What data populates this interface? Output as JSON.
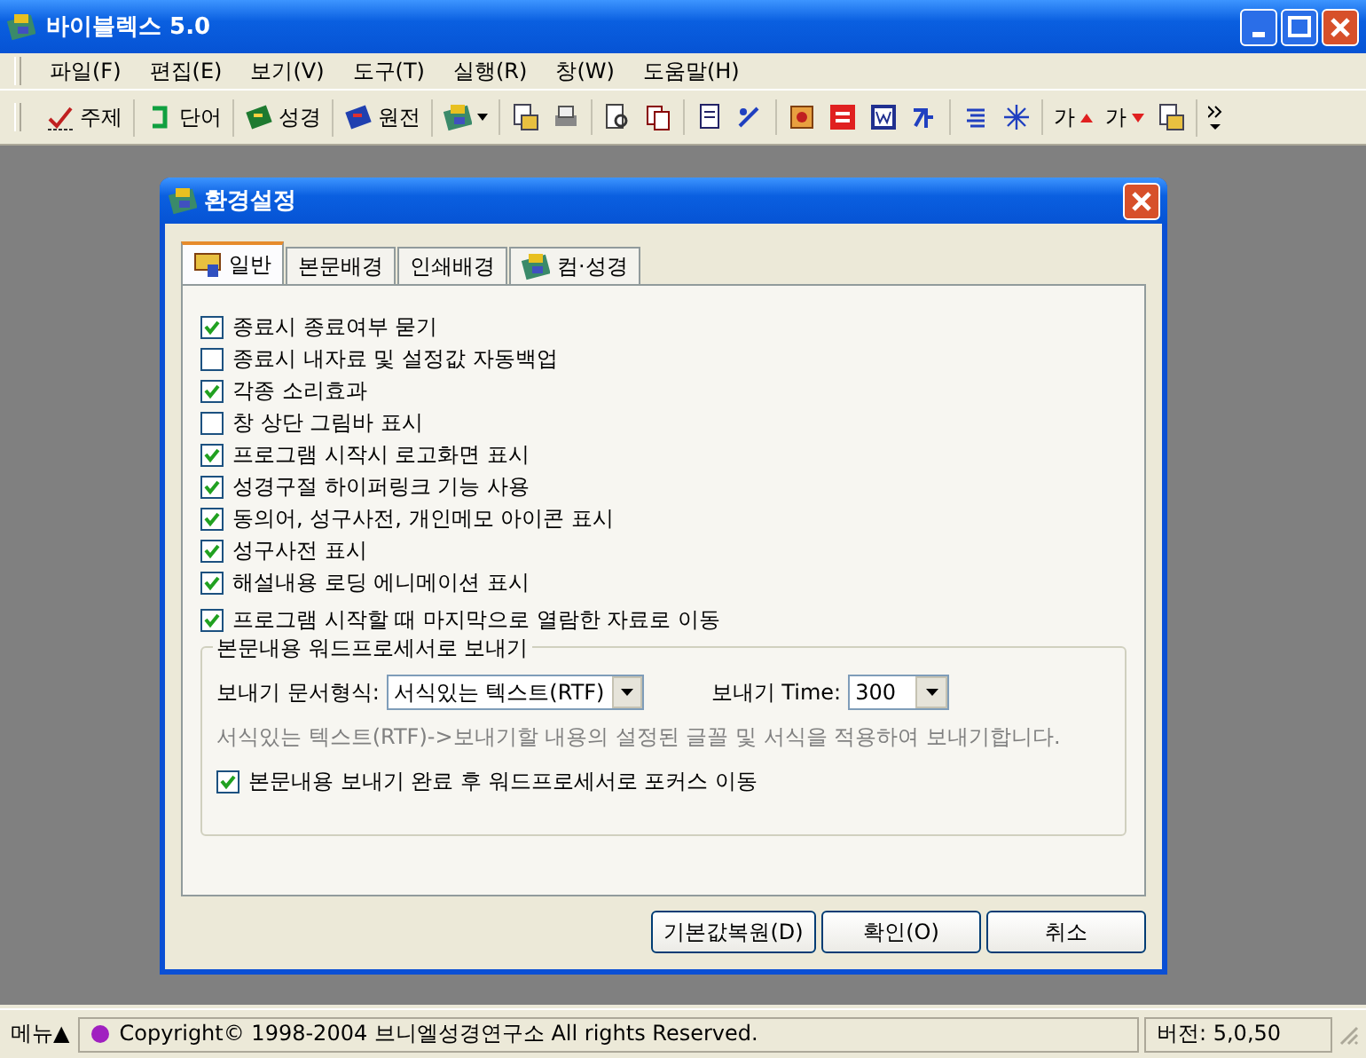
{
  "window": {
    "title": "바이블렉스 5.0"
  },
  "menu": [
    "파일(F)",
    "편집(E)",
    "보기(V)",
    "도구(T)",
    "실행(R)",
    "창(W)",
    "도움말(H)"
  ],
  "toolbar": [
    [
      {
        "kind": "text",
        "label": "주제"
      }
    ],
    [
      {
        "kind": "text",
        "label": "단어"
      }
    ],
    [
      {
        "kind": "text",
        "label": "성경"
      }
    ],
    [
      {
        "kind": "text",
        "label": "원전"
      }
    ],
    [
      {
        "kind": "dropdown"
      }
    ],
    [
      {
        "kind": "icon"
      },
      {
        "kind": "icon"
      }
    ],
    [
      {
        "kind": "icon"
      },
      {
        "kind": "icon"
      }
    ],
    [
      {
        "kind": "icon"
      },
      {
        "kind": "icon"
      }
    ],
    [
      {
        "kind": "icon"
      },
      {
        "kind": "icon"
      },
      {
        "kind": "icon"
      },
      {
        "kind": "icon"
      }
    ],
    [
      {
        "kind": "icon"
      },
      {
        "kind": "icon"
      }
    ],
    [
      {
        "kind": "glyph",
        "label": "가"
      },
      {
        "kind": "glyph",
        "label": "가"
      },
      {
        "kind": "icon"
      }
    ],
    [
      {
        "kind": "more"
      }
    ]
  ],
  "dialog": {
    "title": "환경설정",
    "tabs": [
      {
        "label": "일반",
        "selected": true
      },
      {
        "label": "본문배경",
        "selected": false
      },
      {
        "label": "인쇄배경",
        "selected": false
      },
      {
        "label": "컴·성경",
        "selected": false
      }
    ],
    "options": [
      {
        "label": "종료시 종료여부 묻기",
        "checked": true
      },
      {
        "label": "종료시 내자료 및 설정값 자동백업",
        "checked": false
      },
      {
        "label": "각종 소리효과",
        "checked": true
      },
      {
        "label": "창 상단 그림바 표시",
        "checked": false
      },
      {
        "label": "프로그램 시작시 로고화면 표시",
        "checked": true
      },
      {
        "label": "성경구절 하이퍼링크 기능 사용",
        "checked": true
      },
      {
        "label": "동의어, 성구사전, 개인메모 아이콘 표시",
        "checked": true
      },
      {
        "label": "성구사전 표시",
        "checked": true
      },
      {
        "label": "해설내용 로딩 에니메이션 표시",
        "checked": true
      },
      {
        "label": "프로그램 시작할 때 마지막으로 열람한 자료로 이동",
        "checked": true
      }
    ],
    "export_group": {
      "title": "본문내용 워드프로세서로 보내기",
      "format_label": "보내기 문서형식:",
      "format_value": "서식있는 텍스트(RTF)",
      "time_label": "보내기 Time:",
      "time_value": "300",
      "hint": "서식있는 텍스트(RTF)->보내기할 내용의 설정된 글꼴 및 서식을 적용하여 보내기합니다.",
      "focus_option": {
        "label": "본문내용 보내기 완료 후 워드프로세서로 포커스 이동",
        "checked": true
      }
    },
    "buttons": [
      "기본값복원(D)",
      "확인(O)",
      "취소"
    ]
  },
  "status_bar": {
    "menu": "메뉴▲",
    "copyright": "Copyright© 1998-2004 브니엘성경연구소 All rights Reserved.",
    "version": "버전: 5,0,50"
  }
}
